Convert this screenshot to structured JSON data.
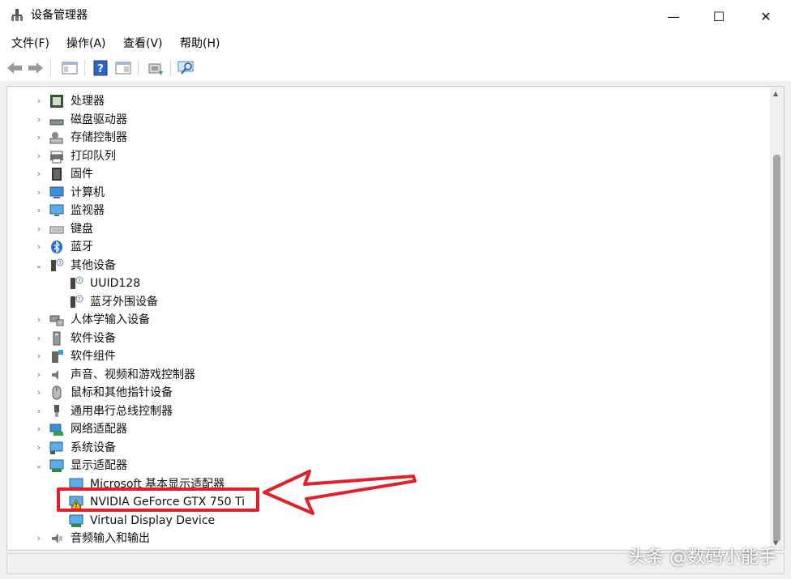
{
  "window": {
    "title": "设备管理器",
    "minimize_glyph": "—",
    "maximize_glyph": "☐",
    "close_glyph": "✕"
  },
  "menu": {
    "file": "文件(F)",
    "action": "操作(A)",
    "view": "查看(V)",
    "help": "帮助(H)"
  },
  "tree": {
    "rows": [
      {
        "label": "处理器",
        "icon": "cpu-icon",
        "expanded": false,
        "level": 0
      },
      {
        "label": "磁盘驱动器",
        "icon": "disk-icon",
        "expanded": false,
        "level": 0
      },
      {
        "label": "存储控制器",
        "icon": "storage-icon",
        "expanded": false,
        "level": 0
      },
      {
        "label": "打印队列",
        "icon": "printer-icon",
        "expanded": false,
        "level": 0
      },
      {
        "label": "固件",
        "icon": "firmware-icon",
        "expanded": false,
        "level": 0
      },
      {
        "label": "计算机",
        "icon": "computer-icon",
        "expanded": false,
        "level": 0
      },
      {
        "label": "监视器",
        "icon": "monitor-icon",
        "expanded": false,
        "level": 0
      },
      {
        "label": "键盘",
        "icon": "keyboard-icon",
        "expanded": false,
        "level": 0
      },
      {
        "label": "蓝牙",
        "icon": "bluetooth-icon",
        "expanded": false,
        "level": 0
      },
      {
        "label": "其他设备",
        "icon": "unknown-device-icon",
        "expanded": true,
        "level": 0
      },
      {
        "label": "UUID128",
        "icon": "unknown-device-icon",
        "level": 1
      },
      {
        "label": "蓝牙外围设备",
        "icon": "unknown-device-icon",
        "level": 1
      },
      {
        "label": "人体学输入设备",
        "icon": "hid-icon",
        "expanded": false,
        "level": 0
      },
      {
        "label": "软件设备",
        "icon": "software-device-icon",
        "expanded": false,
        "level": 0
      },
      {
        "label": "软件组件",
        "icon": "software-component-icon",
        "expanded": false,
        "level": 0
      },
      {
        "label": "声音、视频和游戏控制器",
        "icon": "speaker-icon",
        "expanded": false,
        "level": 0
      },
      {
        "label": "鼠标和其他指针设备",
        "icon": "mouse-icon",
        "expanded": false,
        "level": 0
      },
      {
        "label": "通用串行总线控制器",
        "icon": "usb-icon",
        "expanded": false,
        "level": 0
      },
      {
        "label": "网络适配器",
        "icon": "network-icon",
        "expanded": false,
        "level": 0
      },
      {
        "label": "系统设备",
        "icon": "system-icon",
        "expanded": false,
        "level": 0
      },
      {
        "label": "显示适配器",
        "icon": "display-adapter-icon",
        "expanded": true,
        "level": 0
      },
      {
        "label": "Microsoft 基本显示适配器",
        "icon": "display-adapter-icon",
        "level": 1
      },
      {
        "label": "NVIDIA GeForce GTX 750 Ti",
        "icon": "display-adapter-warning-icon",
        "level": 1
      },
      {
        "label": "Virtual Display Device",
        "icon": "display-adapter-icon",
        "level": 1
      },
      {
        "label": "音频输入和输出",
        "icon": "audio-io-icon",
        "expanded": false,
        "level": 0
      }
    ]
  },
  "watermark": "头条 @数码小能手",
  "colors": {
    "highlight": "#e0212b",
    "accent": "#1e6fd9"
  }
}
